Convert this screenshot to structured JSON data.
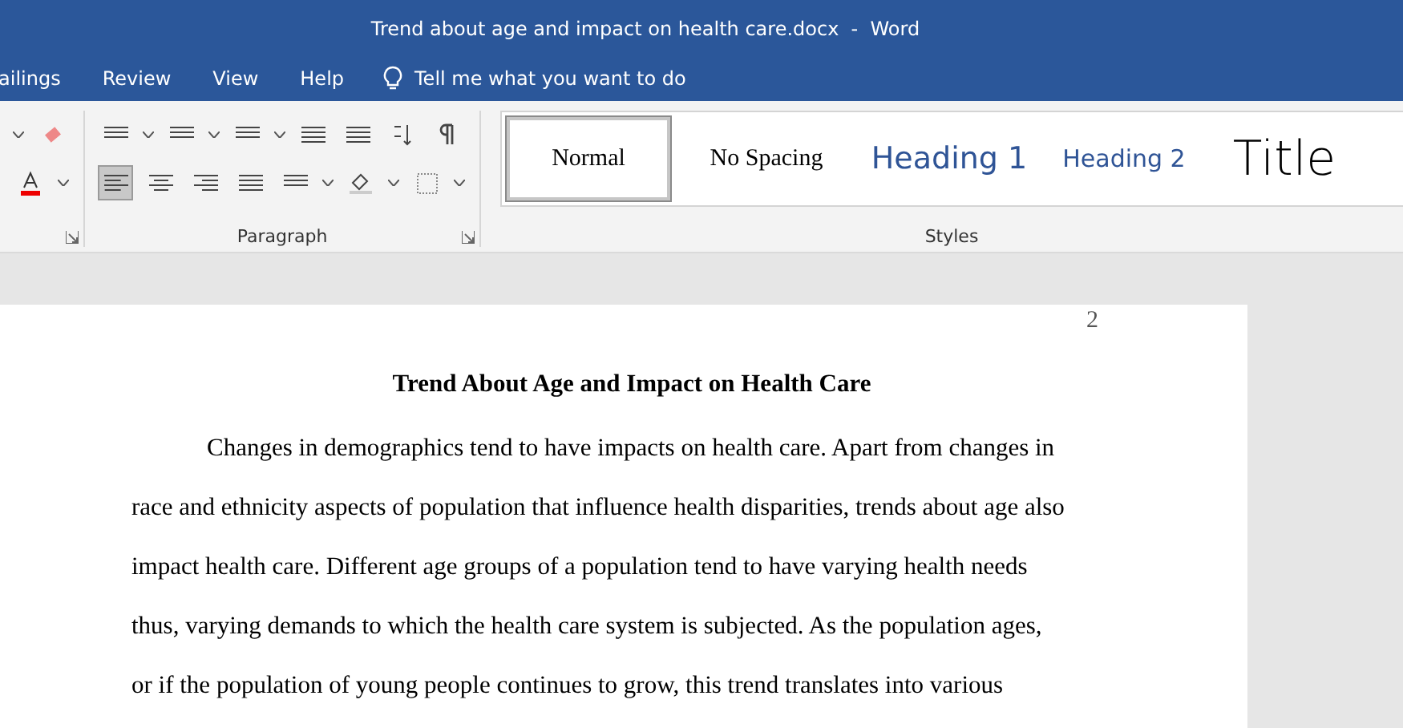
{
  "window": {
    "title": "Trend about age and impact on health care.docx  -  Word"
  },
  "tabs": [
    {
      "label": "ailings",
      "selected": false
    },
    {
      "label": "Review",
      "selected": false
    },
    {
      "label": "View",
      "selected": false
    },
    {
      "label": "Help",
      "selected": false
    }
  ],
  "tell_me": {
    "placeholder": "Tell me what you want to do"
  },
  "ribbon": {
    "paragraph_group": {
      "label": "Paragraph",
      "align_left": {
        "selected": true
      }
    },
    "styles": {
      "label": "Styles",
      "items": [
        {
          "label": "Normal",
          "kind": "normal",
          "selected": true
        },
        {
          "label": "No Spacing",
          "kind": "nospacing",
          "selected": false
        },
        {
          "label": "Heading 1",
          "kind": "heading1",
          "selected": false
        },
        {
          "label": "Heading 2",
          "kind": "heading2",
          "selected": false
        },
        {
          "label": "Title",
          "kind": "title",
          "selected": false
        }
      ]
    }
  },
  "document": {
    "page_number": "2",
    "heading": "Trend About Age and Impact on Health Care",
    "lines": [
      "Changes in demographics tend to have impacts on health care. Apart from changes in",
      "race and ethnicity aspects of population that influence health disparities, trends about age also",
      "impact health care. Different age groups of a population tend to have varying health needs",
      "thus, varying demands to which the health care system is subjected. As the population ages,",
      "or if the population of young people continues to grow, this trend translates into various"
    ]
  }
}
